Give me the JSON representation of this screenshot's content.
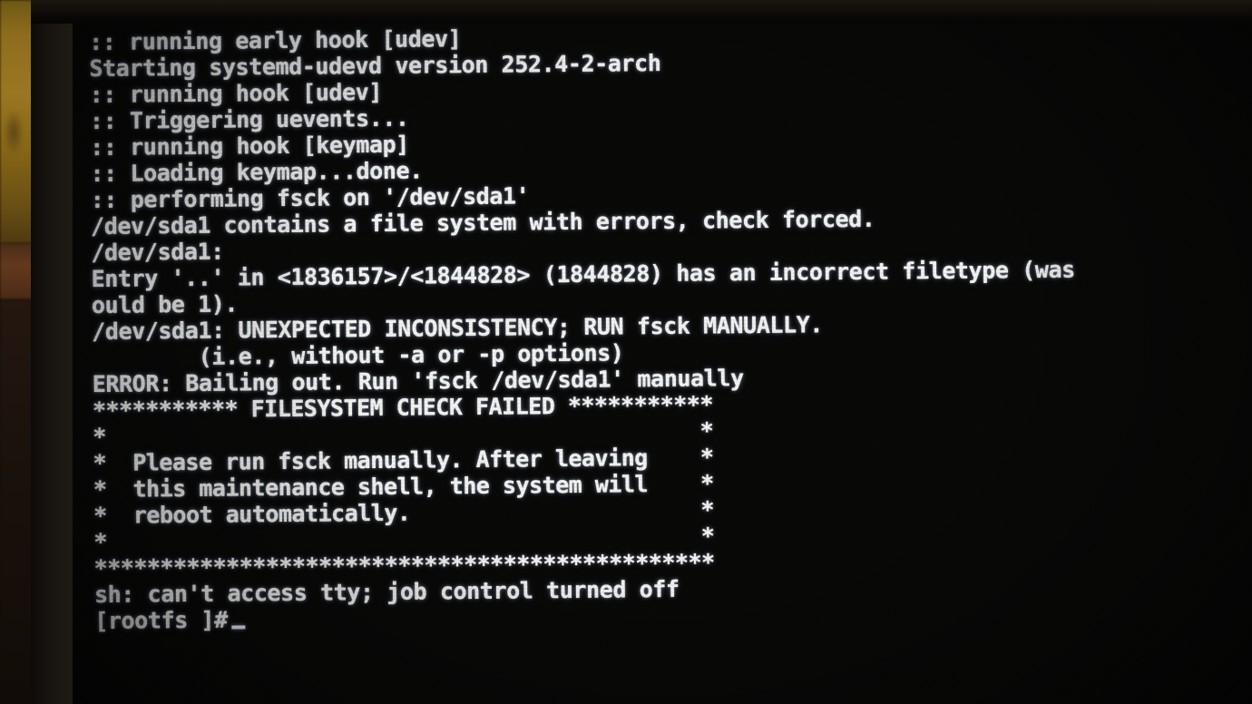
{
  "scene": {
    "kind": "photo-of-monitor",
    "description": "Photograph of a computer monitor displaying a Linux initramfs console after a failed filesystem check",
    "screen_background": "#080807",
    "text_color": "#f2f2ef",
    "ambient_amber": "#9a7722",
    "ambient_desk": "#63391d",
    "bezel": "#181410"
  },
  "console": {
    "lines": [
      ":: running early hook [udev]",
      "Starting systemd-udevd version 252.4-2-arch",
      ":: running hook [udev]",
      ":: Triggering uevents...",
      ":: running hook [keymap]",
      ":: Loading keymap...done.",
      ":: performing fsck on '/dev/sda1'",
      "/dev/sda1 contains a file system with errors, check forced.",
      "/dev/sda1:",
      "Entry '..' in <1836157>/<1844828> (1844828) has an incorrect filetype (was",
      "ould be 1).",
      "",
      "",
      "/dev/sda1: UNEXPECTED INCONSISTENCY; RUN fsck MANUALLY.",
      "        (i.e., without -a or -p options)",
      "ERROR: Bailing out. Run 'fsck /dev/sda1' manually"
    ]
  },
  "banner": {
    "top_rule": "*********** FILESYSTEM CHECK FAILED ***********",
    "rows": [
      "*                                             *",
      "*  Please run fsck manually. After leaving    *",
      "*  this maintenance shell, the system will    *",
      "*  reboot automatically.                      *",
      "*                                             *"
    ],
    "bottom_rule": "***********************************************"
  },
  "shell": {
    "warning": "sh: can't access tty; job control turned off",
    "prompt": "[rootfs ]#",
    "cursor": "_"
  },
  "details": {
    "device": "/dev/sda1",
    "udev_version": "252.4-2-arch",
    "entry": "'..'",
    "parent_inode": "1836157",
    "child_inode": "1844828",
    "dirent_inode": "1844828",
    "expected_filetype": "1"
  }
}
